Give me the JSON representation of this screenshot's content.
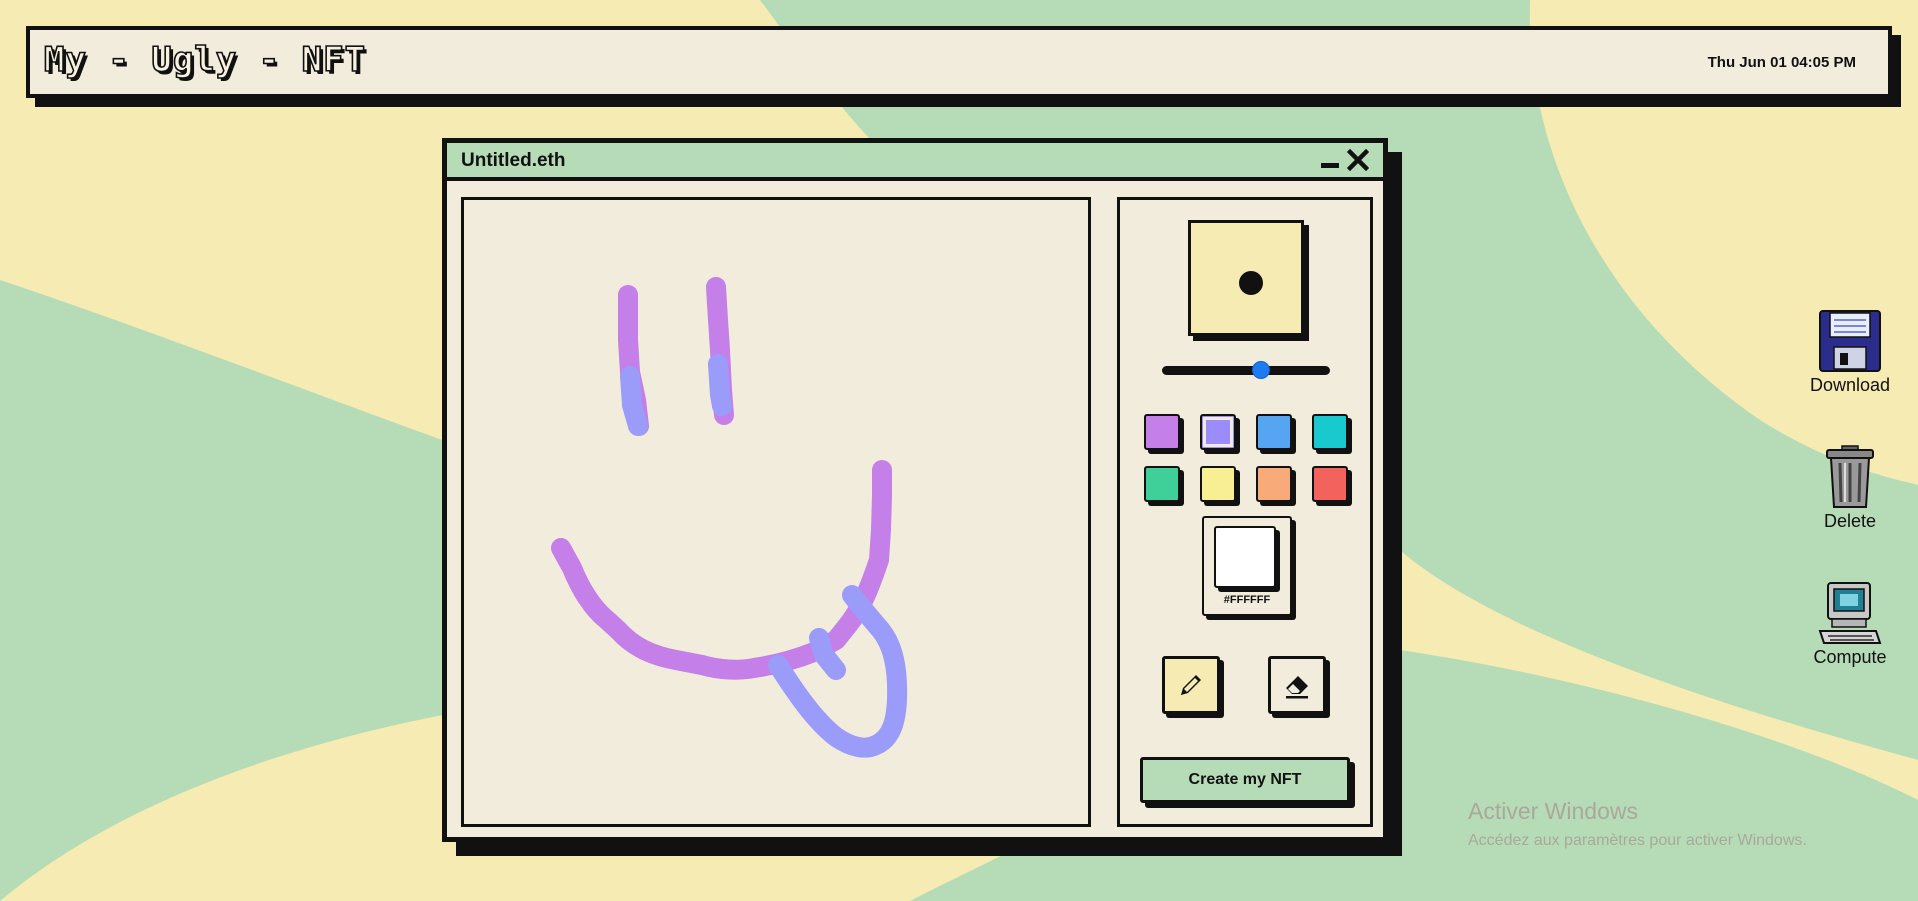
{
  "app": {
    "logo": "My - Ugly - NFT",
    "clock": "Thu Jun 01 04:05 PM"
  },
  "window": {
    "title": "Untitled.eth"
  },
  "tools": {
    "brush_size_fraction": 0.6,
    "palette": [
      {
        "name": "purple",
        "color": "#c47fe8"
      },
      {
        "name": "periwinkle",
        "color": "#9b8cf9"
      },
      {
        "name": "blue",
        "color": "#56a5f3"
      },
      {
        "name": "teal",
        "color": "#18c9cd"
      },
      {
        "name": "green",
        "color": "#3fd09a"
      },
      {
        "name": "yellow",
        "color": "#f8ef95"
      },
      {
        "name": "peach",
        "color": "#f9aa79"
      },
      {
        "name": "red",
        "color": "#f4625e"
      }
    ],
    "selected_color_index": 1,
    "custom_color_hex": "#FFFFFF",
    "active_tool": "pencil",
    "create_label": "Create my NFT"
  },
  "desktop": {
    "icons": [
      {
        "name": "floppy-disk-icon",
        "label": "Download"
      },
      {
        "name": "trash-icon",
        "label": "Delete"
      },
      {
        "name": "computer-icon",
        "label": "Compute"
      }
    ]
  },
  "watermark": {
    "title": "Activer Windows",
    "subtitle": "Accédez aux paramètres pour activer Windows."
  },
  "colors": {
    "background_yellow": "#f6ebb2",
    "background_green": "#b6dcb7",
    "panel": "#f2ecdc",
    "stroke_purple": "#c47fe8",
    "stroke_periwinkle": "#9b9bf9"
  }
}
